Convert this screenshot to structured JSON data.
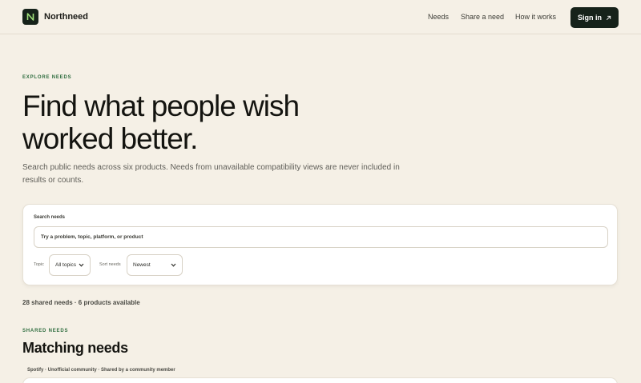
{
  "brand": {
    "name": "Northneed",
    "logo_icon": "northneed-logo-icon"
  },
  "nav": {
    "items": [
      "Needs",
      "Share a need",
      "How it works"
    ]
  },
  "signin": {
    "label": "Sign in",
    "icon": "arrow-up-right-icon"
  },
  "hero": {
    "eyebrow": "EXPLORE NEEDS",
    "title_line1": "Find what people wish",
    "title_line2": "worked better.",
    "subtitle": "Search public needs across six products. Needs from unavailable compatibility views are never included in results or counts."
  },
  "search": {
    "label": "Search needs",
    "placeholder": "Try a problem, topic, platform, or product",
    "value": "",
    "topic_label": "Topic",
    "topic_value": "All topics",
    "sort_label": "Sort needs",
    "sort_value": "Newest"
  },
  "results": {
    "summary": "28 shared needs · 6 products available"
  },
  "matching": {
    "eyebrow": "SHARED NEEDS",
    "title": "Matching needs",
    "first_card_meta": "Spotify · Unofficial community · Shared by a community member"
  },
  "colors": {
    "background": "#f5f0e6",
    "accent": "#2f6d3f",
    "dark": "#16221a"
  }
}
